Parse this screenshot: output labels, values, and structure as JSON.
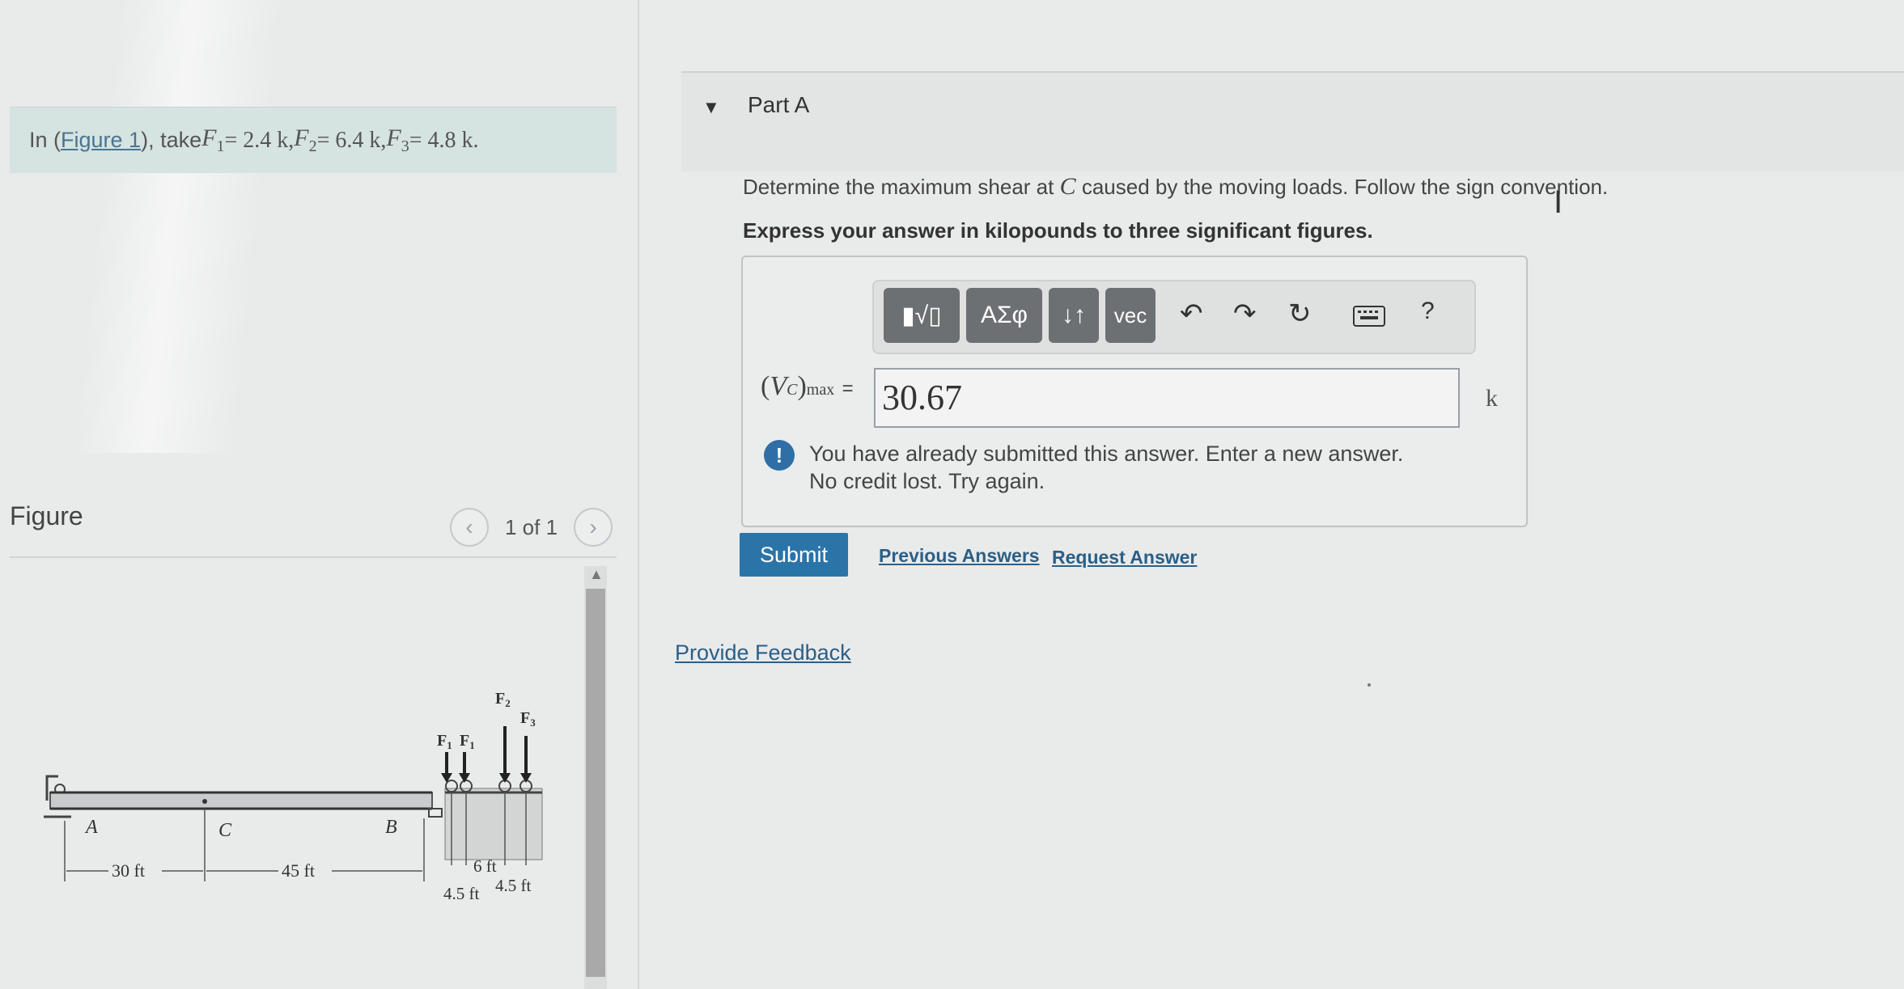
{
  "problem": {
    "prefix": "In (",
    "figure_link": "Figure 1",
    "middle": "), take ",
    "f1_label": "F",
    "f1_sub": "1",
    "f1_value": " = 2.4 k, ",
    "f2_label": "F",
    "f2_sub": "2",
    "f2_value": " = 6.4 k, ",
    "f3_label": "F",
    "f3_sub": "3",
    "f3_value": " = 4.8 k."
  },
  "figure": {
    "label": "Figure",
    "counter": "1 of 1",
    "prev_icon": "chevron-left-icon",
    "next_icon": "chevron-right-icon",
    "labels": {
      "A": "A",
      "B": "B",
      "C": "C",
      "F1a": "F",
      "F1b": "F",
      "F2": "F",
      "F3": "F",
      "sub1": "1",
      "sub2": "2",
      "sub3": "3",
      "dim_30": "30 ft",
      "dim_45": "45 ft",
      "dim_6": "6 ft",
      "dim_45a": "4.5 ft",
      "dim_45b": "4.5 ft"
    }
  },
  "part": {
    "caret_icon": "caret-down-icon",
    "title": "Part A",
    "question_pre": "Determine the maximum shear at ",
    "question_var": "C",
    "question_post": " caused by the moving loads. Follow the sign convention.",
    "instruction": "Express your answer in kilopounds to three significant figures."
  },
  "toolbar": {
    "templates_label": "▮√▯",
    "greek_label": "ΑΣφ",
    "arrows_label": "↓↑",
    "vec_label": "vec",
    "undo_icon": "undo-icon",
    "redo_icon": "redo-icon",
    "reset_icon": "reset-icon",
    "keyboard_icon": "keyboard-icon",
    "help_label": "?"
  },
  "answer": {
    "lhs_var": "V",
    "lhs_var_sub": "C",
    "lhs_sub": "max",
    "equals": "=",
    "value": "30.67",
    "unit": "k"
  },
  "alert": {
    "icon": "!",
    "line1": "You have already submitted this answer. Enter a new answer.",
    "line2": "No credit lost. Try again."
  },
  "actions": {
    "submit": "Submit",
    "previous_answers": "Previous Answers",
    "request_answer": "Request Answer",
    "provide_feedback": "Provide Feedback"
  },
  "colors": {
    "submit_bg": "#2b74a8",
    "link": "#2b5f86",
    "problem_bg": "#d5e3e1",
    "alert_icon": "#2f6fa5"
  }
}
